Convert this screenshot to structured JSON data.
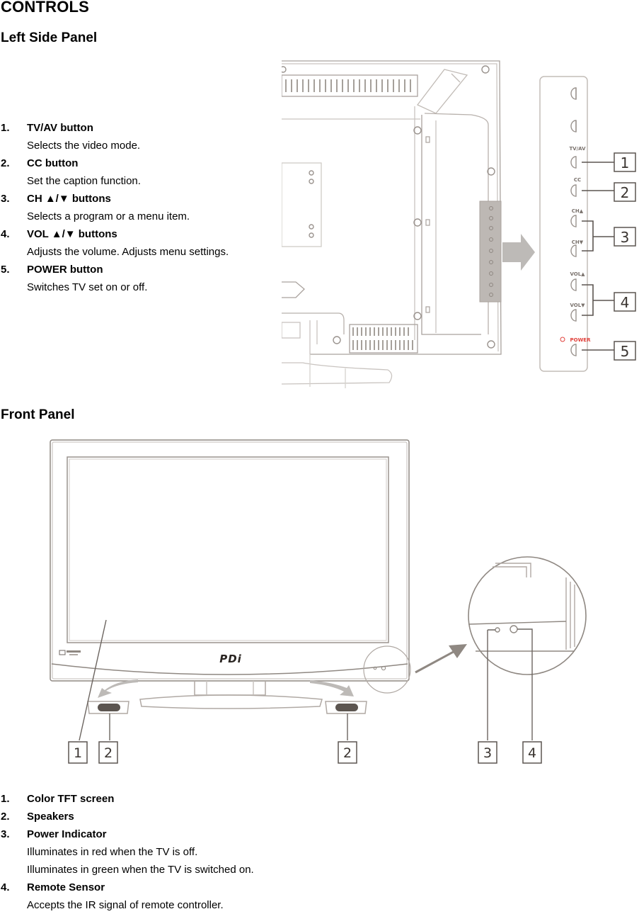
{
  "document": {
    "title": "CONTROLS"
  },
  "left_side_panel": {
    "heading": "Left Side Panel",
    "items": [
      {
        "number": "1.",
        "label": "TV/AV button",
        "description": "Selects the video mode."
      },
      {
        "number": "2.",
        "label": "CC button",
        "description": "Set the caption function."
      },
      {
        "number": "3.",
        "label": "CH ▲/▼ buttons",
        "description": "Selects a program or a menu item."
      },
      {
        "number": "4.",
        "label": "VOL ▲/▼ buttons",
        "description": "Adjusts the volume. Adjusts menu settings."
      },
      {
        "number": "5.",
        "label": "POWER button",
        "description": "Switches TV set on or off."
      }
    ],
    "diagram": {
      "panel_labels": [
        "TV/AV",
        "CC",
        "CH▲",
        "CH▼",
        "VOL▲",
        "VOL▼",
        "POWER"
      ],
      "callouts": [
        "1",
        "2",
        "3",
        "4",
        "5"
      ],
      "power_label_color": "#e0403a"
    }
  },
  "front_panel": {
    "heading": "Front Panel",
    "brand_logo": "PDi",
    "callouts": [
      "1",
      "2",
      "2",
      "3",
      "4"
    ],
    "items": [
      {
        "number": "1.",
        "label": "Color TFT screen",
        "descriptions": []
      },
      {
        "number": "2.",
        "label": "Speakers",
        "descriptions": []
      },
      {
        "number": "3.",
        "label": "Power Indicator",
        "descriptions": [
          "Illuminates in red when the TV is off.",
          "Illuminates in green when the TV is switched on."
        ]
      },
      {
        "number": "4.",
        "label": "Remote Sensor",
        "descriptions": [
          "Accepts the IR signal of remote controller."
        ]
      }
    ]
  }
}
